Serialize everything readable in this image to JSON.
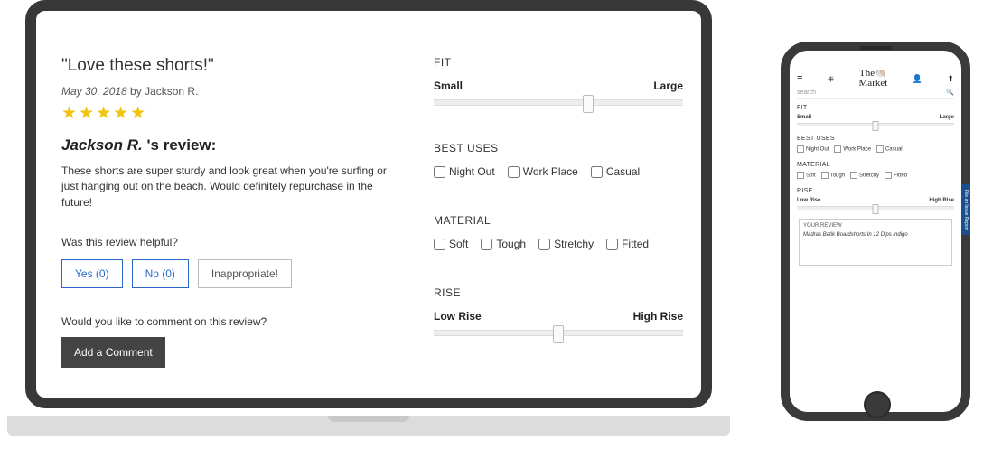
{
  "review": {
    "title": "\"Love these shorts!\"",
    "date": "May 30, 2018",
    "by_prefix": " by ",
    "author": "Jackson R.",
    "stars": "★★★★★",
    "heading_name": "Jackson R. ",
    "heading_suffix": "'s review:",
    "body": "These shorts are super sturdy and look great when you're surfing or just hanging out on the beach. Would definitely repurchase in the future!",
    "helpful_q": "Was this review helpful?",
    "yes": "Yes (0)",
    "no": "No (0)",
    "inappropriate": "Inappropriate!",
    "comment_q": "Would you like to comment on this review?",
    "add_comment": "Add a Comment"
  },
  "attr": {
    "fit": {
      "title": "FIT",
      "left": "Small",
      "right": "Large",
      "pos": 62
    },
    "best_uses": {
      "title": "BEST USES",
      "options": [
        "Night Out",
        "Work Place",
        "Casual"
      ]
    },
    "material": {
      "title": "MATERIAL",
      "options": [
        "Soft",
        "Tough",
        "Stretchy",
        "Fitted"
      ]
    },
    "rise": {
      "title": "RISE",
      "left": "Low Rise",
      "right": "High Rise",
      "pos": 50
    }
  },
  "phone": {
    "logo_a": "The",
    "logo_b": "Market",
    "search_placeholder": "search",
    "fit": {
      "title": "FIT",
      "left": "Small",
      "right": "Large",
      "pos": 50
    },
    "best_uses": {
      "title": "BEST USES",
      "options": [
        "Night Out",
        "Work Place",
        "Casual"
      ]
    },
    "material": {
      "title": "MATERIAL",
      "options": [
        "Soft",
        "Tough",
        "Stretchy",
        "Fitted"
      ]
    },
    "rise": {
      "title": "RISE",
      "left": "Low Rise",
      "right": "High Rise",
      "pos": 50
    },
    "your_title": "YOUR REVIEW",
    "product": "Madras Batik Boardshorts In 12 Dips Indigo",
    "feedback": "File an Issue Report"
  }
}
